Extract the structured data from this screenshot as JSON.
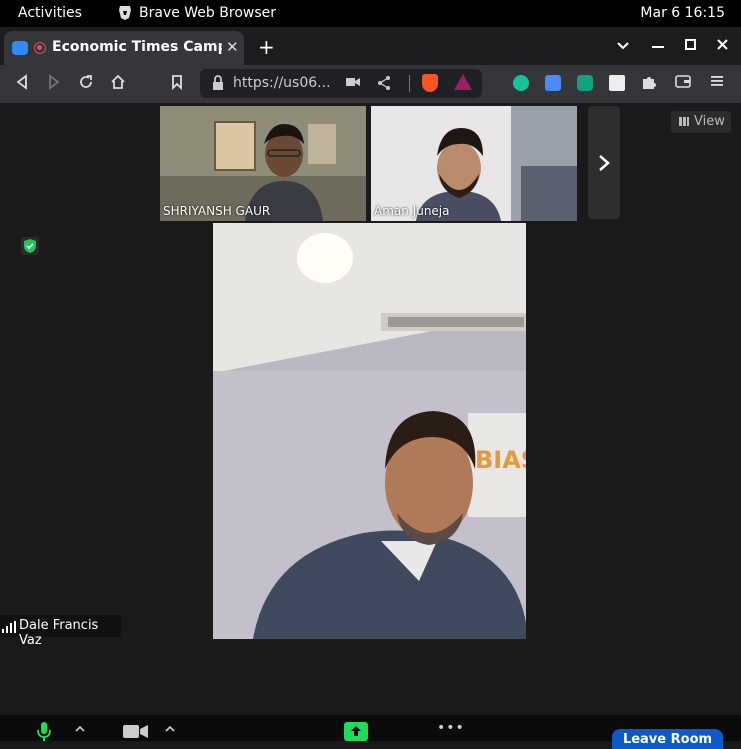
{
  "topbar": {
    "activities": "Activities",
    "app_name": "Brave Web Browser",
    "datetime": "Mar 6  16:15"
  },
  "tab": {
    "title": "Economic Times Campus",
    "close": "✕"
  },
  "toolbar": {
    "url": "https://us06...",
    "new_tab": "+"
  },
  "meeting": {
    "participants": [
      {
        "name": "SHRIYANSH GAUR"
      },
      {
        "name": "Aman Juneja"
      }
    ],
    "view_label": "View",
    "active_speaker": "Dale Francis Vaz",
    "leave_label": "Leave Room",
    "more": "•••"
  },
  "colors": {
    "accent": "#0e5ac8",
    "zoom_blue": "#2d8cff",
    "share_green": "#23d959",
    "mic_green": "#23d959"
  }
}
